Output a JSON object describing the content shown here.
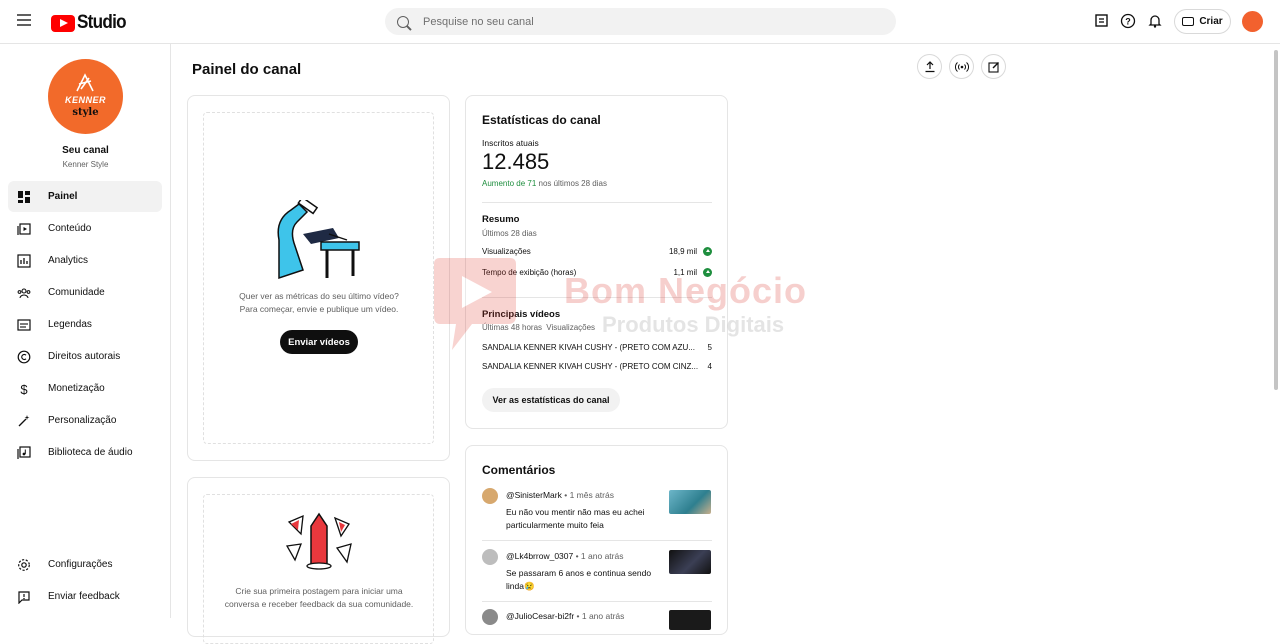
{
  "topbar": {
    "app_name": "Studio",
    "search_placeholder": "Pesquise no seu canal",
    "create_label": "Criar"
  },
  "sidebar": {
    "channel_title": "Seu canal",
    "channel_name": "Kenner Style",
    "logo_text_1": "KENNER",
    "logo_text_2": "style",
    "items": [
      {
        "label": "Painel",
        "icon": "dashboard-icon"
      },
      {
        "label": "Conteúdo",
        "icon": "content-icon"
      },
      {
        "label": "Analytics",
        "icon": "analytics-icon"
      },
      {
        "label": "Comunidade",
        "icon": "community-icon"
      },
      {
        "label": "Legendas",
        "icon": "subtitles-icon"
      },
      {
        "label": "Direitos autorais",
        "icon": "copyright-icon"
      },
      {
        "label": "Monetização",
        "icon": "dollar-icon"
      },
      {
        "label": "Personalização",
        "icon": "magic-wand-icon"
      },
      {
        "label": "Biblioteca de áudio",
        "icon": "audio-library-icon"
      }
    ],
    "bottom": [
      {
        "label": "Configurações",
        "icon": "gear-icon"
      },
      {
        "label": "Enviar feedback",
        "icon": "feedback-icon"
      }
    ]
  },
  "main": {
    "page_title": "Painel do canal",
    "latest_video_card": {
      "line1": "Quer ver as métricas do seu último vídeo?",
      "line2": "Para começar, envie e publique um vídeo.",
      "button": "Enviar vídeos"
    },
    "community_card": {
      "line1": "Crie sua primeira postagem para iniciar uma",
      "line2": "conversa e receber feedback da sua comunidade."
    },
    "stats": {
      "title": "Estatísticas do canal",
      "subs_label": "Inscritos atuais",
      "subs_value": "12.485",
      "growth_prefix": "Aumento de 71",
      "growth_suffix": " nos últimos 28 dias",
      "summary_title": "Resumo",
      "summary_period": "Últimos 28 dias",
      "views_label": "Visualizações",
      "views_value": "18,9 mil",
      "watch_label": "Tempo de exibição (horas)",
      "watch_value": "1,1 mil",
      "top_videos_title": "Principais vídeos",
      "top_period": "Últimas 48 horas",
      "top_col": "Visualizações",
      "videos": [
        {
          "title": "SANDALIA KENNER KIVAH CUSHY - (PRETO COM AZU...",
          "views": "5"
        },
        {
          "title": "SANDALIA KENNER KIVAH CUSHY - (PRETO COM CINZ...",
          "views": "4"
        }
      ],
      "button": "Ver as estatísticas do canal"
    },
    "comments": {
      "title": "Comentários",
      "items": [
        {
          "author": "@SinisterMark",
          "when": " • 1 mês atrás",
          "text": "Eu não vou mentir não mas eu achei particularmente muito feia"
        },
        {
          "author": "@Lk4brrow_0307",
          "when": " • 1 ano atrás",
          "text": "Se passaram 6 anos e continua sendo linda😢"
        },
        {
          "author": "@JulioCesar-bi2fr",
          "when": " • 1 ano atrás",
          "text": ""
        }
      ]
    }
  },
  "watermark": {
    "line1": "Bom Negócio",
    "line2": "Produtos Digitais"
  },
  "colors": {
    "brand_red": "#ff0000",
    "channel_orange": "#f26a2a",
    "growth_green": "#1e8e3e"
  }
}
